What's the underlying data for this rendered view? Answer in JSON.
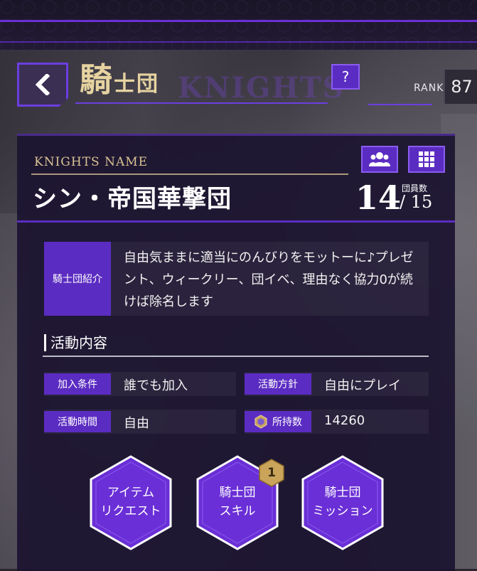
{
  "header": {
    "title_main": "騎",
    "title_rest": "士団",
    "watermark": "KNIGHTS",
    "help_label": "?",
    "rank_label": "RANK",
    "rank_value": "87"
  },
  "knights": {
    "name_label": "KNIGHTS NAME",
    "name": "シン・帝国華撃団",
    "members_label": "団員数",
    "members_count": "14",
    "members_max": "/ 15"
  },
  "intro": {
    "label": "騎士団紹介",
    "text": "自由気ままに適当にのんびりをモットーに♪プレゼント、ウィークリー、団イベ、理由なく協力0が続けば除名します"
  },
  "activity": {
    "title": "活動内容",
    "join_condition_label": "加入条件",
    "join_condition_value": "誰でも加入",
    "policy_label": "活動方針",
    "policy_value": "自由にプレイ",
    "time_label": "活動時間",
    "time_value": "自由",
    "owned_label": "所持数",
    "owned_value": "14260"
  },
  "buttons": {
    "item_request": [
      "アイテム",
      "リクエスト"
    ],
    "skill": [
      "騎士団",
      "スキル"
    ],
    "skill_badge": "1",
    "mission": [
      "騎士団",
      "ミッション"
    ]
  },
  "colors": {
    "accent": "#5b2cc2",
    "gold": "#d9c393",
    "panel": "#1c1430"
  }
}
